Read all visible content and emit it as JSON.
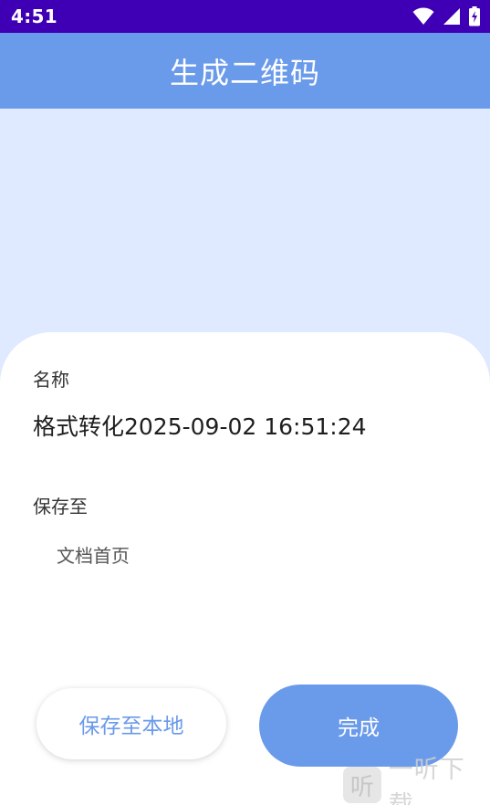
{
  "status_bar": {
    "time": "4:51",
    "icons": [
      "wifi-icon",
      "cellular-signal-icon",
      "battery-charging-icon"
    ],
    "background": "#3f00b5"
  },
  "app_bar": {
    "title": "生成二维码",
    "background": "#6a9aea"
  },
  "form": {
    "name_label": "名称",
    "name_value": "格式转化2025-09-02 16:51:24",
    "save_to_label": "保存至",
    "save_location": "文档首页"
  },
  "buttons": {
    "save_local": "保存至本地",
    "done": "完成"
  },
  "watermark": {
    "logo_glyph": "听",
    "text": "一听下载"
  },
  "colors": {
    "accent": "#6a9aea",
    "preview_background": "#dfe9ff",
    "sheet_background": "#ffffff"
  }
}
